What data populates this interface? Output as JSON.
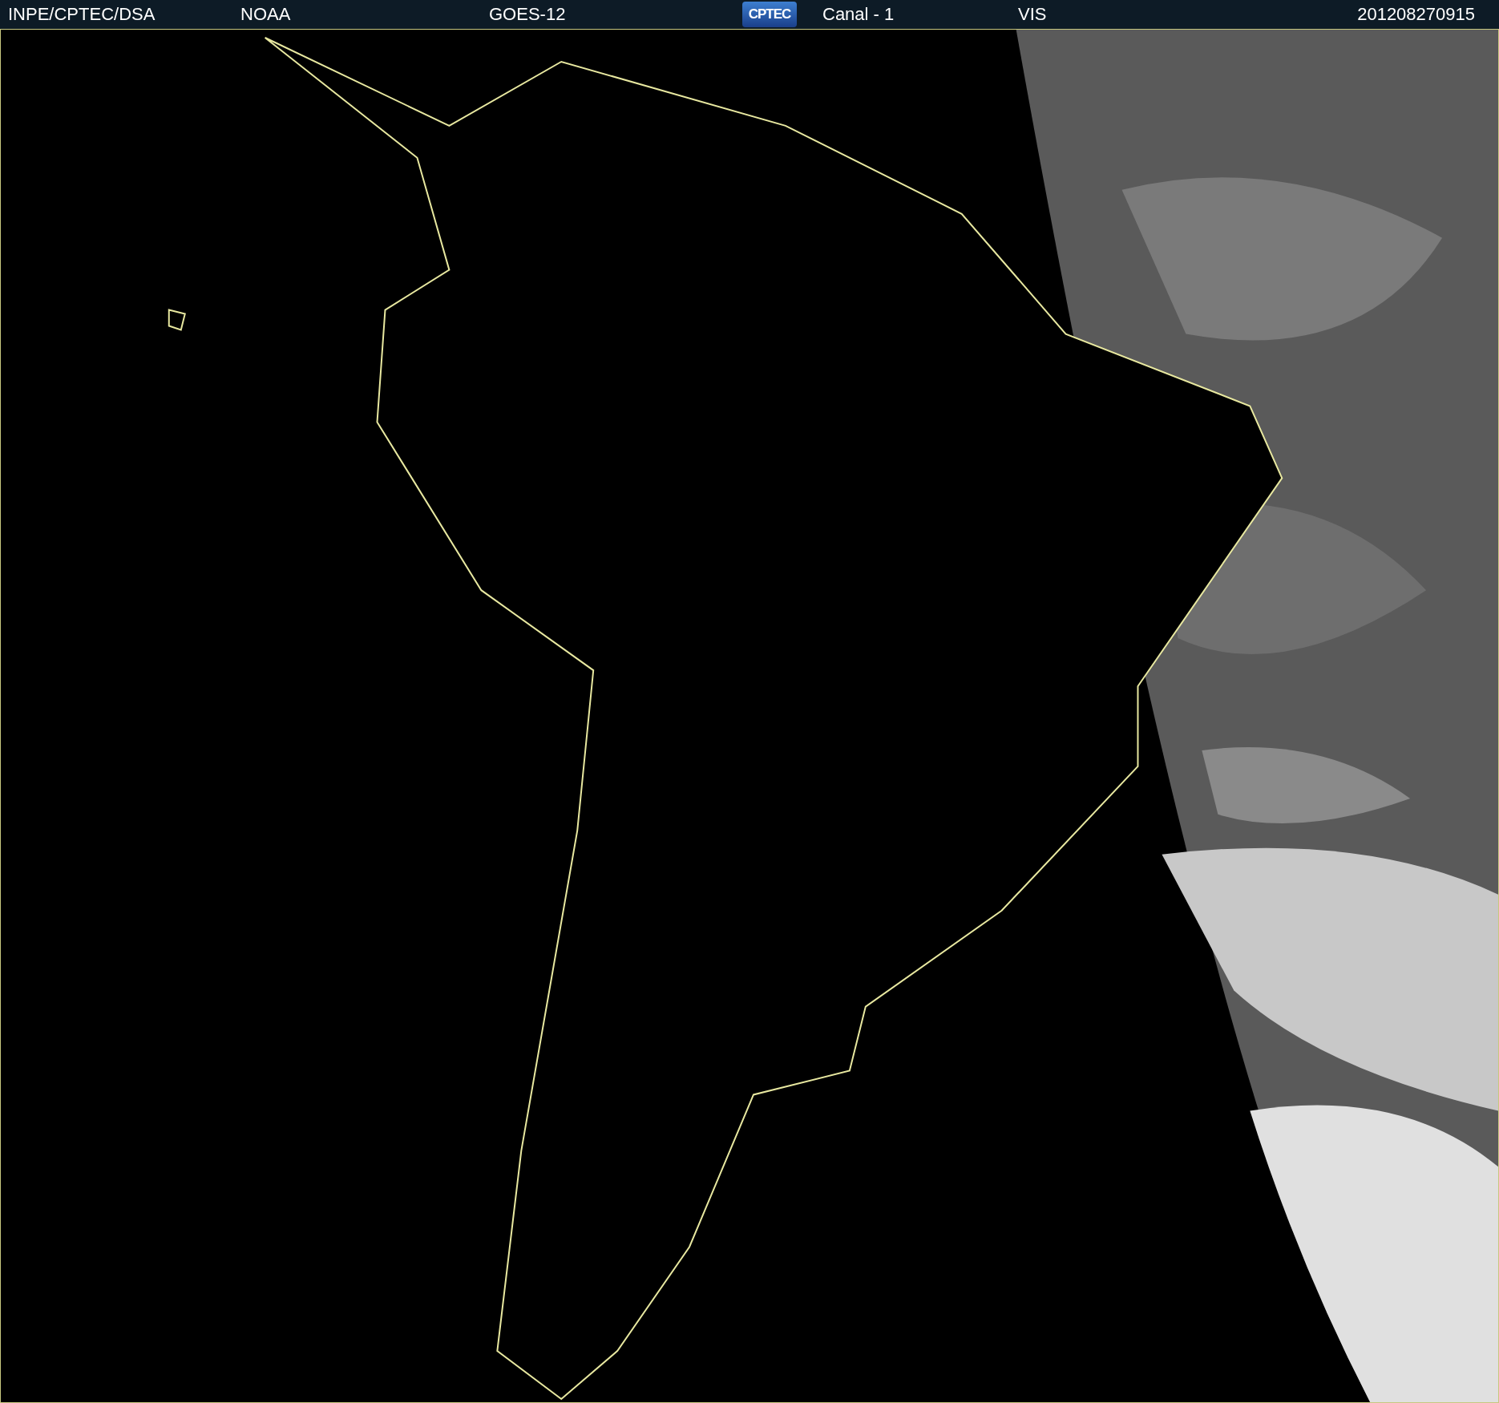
{
  "header": {
    "source": "INPE/CPTEC/DSA",
    "agency": "NOAA",
    "satellite": "GOES-12",
    "logo": "CPTEC",
    "channel": "Canal - 1",
    "band": "VIS",
    "timestamp": "201208270915"
  }
}
